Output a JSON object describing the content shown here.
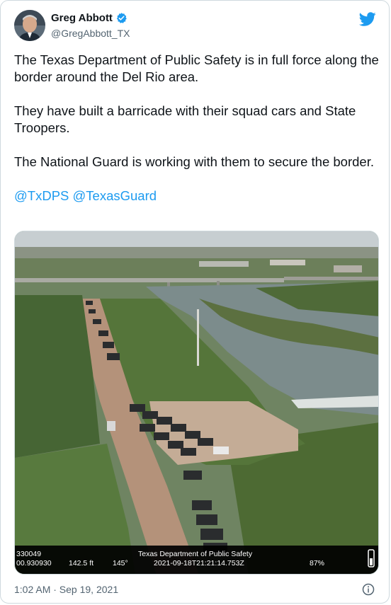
{
  "author": {
    "name": "Greg Abbott",
    "handle": "@GregAbbott_TX"
  },
  "tweet": {
    "paragraphs": [
      "The Texas Department of Public Safety is in full force along the border around the Del Rio area.",
      "They have built a barricade with their squad cars and State Troopers.",
      "The National Guard is working with them to secure the border."
    ],
    "mentions": [
      "@TxDPS",
      "@TexasGuard"
    ]
  },
  "media": {
    "overlay": {
      "left_top": "330049",
      "left_bottom": "00.930930",
      "altitude": "142.5 ft",
      "heading": "145°",
      "agency": "Texas Department of Public Safety",
      "timestamp": "2021-09-18T21:21:14.753Z",
      "battery": "87%"
    }
  },
  "timestamp": "1:02 AM · Sep 19, 2021",
  "icons": {
    "verified": "verified-badge-icon",
    "brand": "twitter-bird-icon",
    "info": "info-icon"
  },
  "colors": {
    "link": "#1d9bf0",
    "secondary_text": "#536471"
  }
}
